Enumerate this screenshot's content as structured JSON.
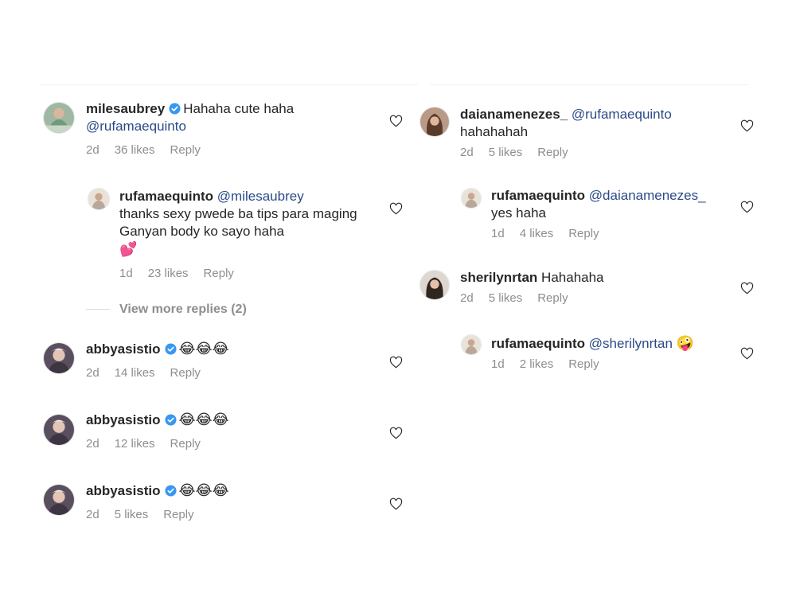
{
  "left_column": {
    "comments": [
      {
        "username": "milesaubrey",
        "verified": true,
        "text": "Hahaha cute haha",
        "mention": "@rufamaequinto",
        "age": "2d",
        "likes": "36 likes",
        "reply": "Reply",
        "replies": [
          {
            "username": "rufamaequinto",
            "mention": "@milesaubrey",
            "text": "thanks sexy pwede ba tips para maging Ganyan body ko sayo haha",
            "emoji": "💕",
            "age": "1d",
            "likes": "23 likes",
            "reply": "Reply"
          }
        ],
        "view_more": "View more replies (2)"
      },
      {
        "username": "abbyasistio",
        "verified": true,
        "emoji": "😂😂😂",
        "age": "2d",
        "likes": "14 likes",
        "reply": "Reply"
      },
      {
        "username": "abbyasistio",
        "verified": true,
        "emoji": "😂😂😂",
        "age": "2d",
        "likes": "12 likes",
        "reply": "Reply"
      },
      {
        "username": "abbyasistio",
        "verified": true,
        "emoji": "😂😂😂",
        "age": "2d",
        "likes": "5 likes",
        "reply": "Reply"
      }
    ]
  },
  "right_column": {
    "comments": [
      {
        "username": "daianamenezes_",
        "mention": "@rufamaequinto",
        "text": "hahahahah",
        "age": "2d",
        "likes": "5 likes",
        "reply": "Reply",
        "replies": [
          {
            "username": "rufamaequinto",
            "mention": "@daianamenezes_",
            "text": "yes haha",
            "age": "1d",
            "likes": "4 likes",
            "reply": "Reply"
          }
        ]
      },
      {
        "username": "sherilynrtan",
        "text": "Hahahaha",
        "age": "2d",
        "likes": "5 likes",
        "reply": "Reply",
        "replies": [
          {
            "username": "rufamaequinto",
            "mention": "@sherilynrtan",
            "emoji": "🤪",
            "age": "1d",
            "likes": "2 likes",
            "reply": "Reply"
          }
        ]
      }
    ]
  },
  "icons": {
    "verified": "verified-badge-icon",
    "like": "heart-outline-icon"
  },
  "colors": {
    "mention": "#2b4a86",
    "meta": "#8e8e8e",
    "verified": "#3897f0",
    "username": "#262626"
  }
}
